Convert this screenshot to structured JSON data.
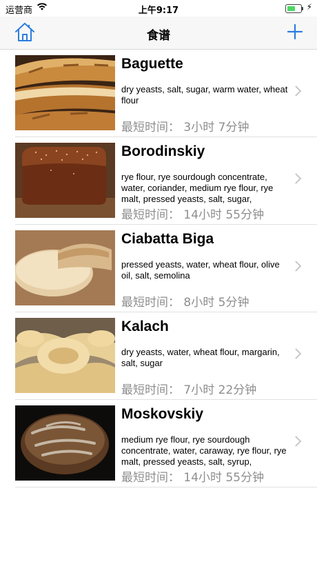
{
  "status": {
    "carrier": "运营商",
    "time": "上午9:17",
    "battery_level": 0.5,
    "wifi_icon": "wifi-icon",
    "charging_icon": "bolt-icon"
  },
  "nav": {
    "title": "食谱",
    "left_icon": "home-icon",
    "right_icon": "plus-icon",
    "accent": "#2a7de1"
  },
  "recipes": [
    {
      "name": "Baguette",
      "ingredients": "dry yeasts, salt, sugar, warm water, wheat flour",
      "time": "最短时间：   3小时 7分钟"
    },
    {
      "name": "Borodinskiy",
      "ingredients": "rye flour, rye sourdough concentrate, water, coriander, medium rye flour, rye malt, pressed yeasts, salt, sugar,",
      "time": "最短时间：   14小时 55分钟"
    },
    {
      "name": "Ciabatta Biga",
      "ingredients": "pressed yeasts, water, wheat flour, olive oil, salt, semolina",
      "time": "最短时间：   8小时 5分钟"
    },
    {
      "name": "Kalach",
      "ingredients": "dry yeasts, water, wheat flour, margarin, salt, sugar",
      "time": "最短时间：   7小时 22分钟"
    },
    {
      "name": "Moskovskiy",
      "ingredients": "medium rye flour, rye sourdough concentrate, water, caraway, rye flour, rye malt, pressed yeasts, salt, syrup,",
      "time": "最短时间：   14小时 55分钟"
    }
  ]
}
